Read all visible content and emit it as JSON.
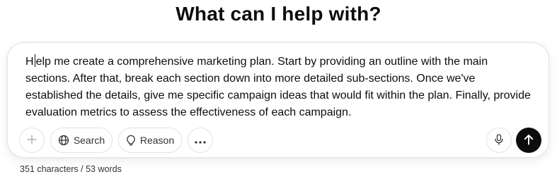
{
  "header": {
    "title": "What can I help with?"
  },
  "composer": {
    "text_before_caret": "H",
    "text_after_caret": "elp me create a comprehensive marketing plan. Start by providing an outline with the main sections. After that, break each section down into more detailed sub-sections. Once we've established the details, give me specific campaign ideas that would fit within the plan. Finally, provide evaluation metrics to assess the effectiveness of each campaign.",
    "buttons": {
      "attach_icon": "plus-icon",
      "search_label": "Search",
      "search_icon": "globe-icon",
      "reason_label": "Reason",
      "reason_icon": "lightbulb-icon",
      "more_icon": "ellipsis-icon",
      "voice_icon": "microphone-icon",
      "send_icon": "arrow-up-icon"
    }
  },
  "footer": {
    "counter": "351 characters / 53 words"
  },
  "colors": {
    "send_button_bg": "#0d0d0d",
    "border": "#e5e5e5",
    "text": "#0d0d0d"
  }
}
